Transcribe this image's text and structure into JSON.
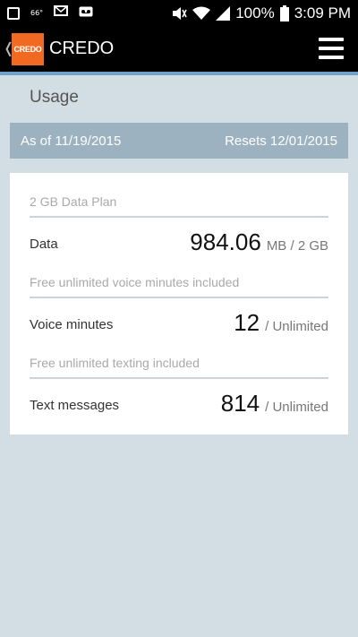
{
  "status_bar": {
    "weather_temp": "66°",
    "battery": "100%",
    "time": "3:09 PM"
  },
  "app_bar": {
    "logo_text": "CREDO",
    "title": "CREDO"
  },
  "page": {
    "title": "Usage",
    "as_of": "As of 11/19/2015",
    "resets": "Resets 12/01/2015"
  },
  "usage": {
    "data_plan_note": "2 GB Data Plan",
    "data_label": "Data",
    "data_value": "984.06",
    "data_unit": "MB / 2 GB",
    "voice_note": "Free unlimited voice minutes included",
    "voice_label": "Voice minutes",
    "voice_value": "12",
    "voice_unit": "/ Unlimited",
    "text_note": "Free unlimited texting included",
    "text_label": "Text messages",
    "text_value": "814",
    "text_unit": "/ Unlimited"
  },
  "colors": {
    "brand_orange": "#f26a21",
    "accent_blue": "#6fa3cc",
    "date_bar": "#9db2c0",
    "background": "#d3dde4"
  },
  "icons": [
    "image-icon",
    "weather-icon",
    "email-icon",
    "voicemail-icon",
    "mute-icon",
    "wifi-icon",
    "signal-icon",
    "battery-icon",
    "back-chevron-icon",
    "hamburger-menu-icon"
  ]
}
